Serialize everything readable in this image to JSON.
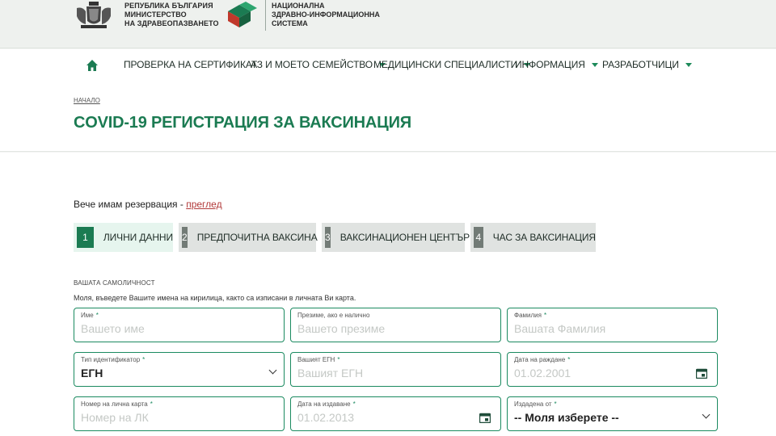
{
  "header": {
    "gov_lines": [
      "РЕПУБЛИКА БЪЛГАРИЯ",
      "МИНИСТЕРСТВО",
      "НА ЗДРАВЕОПАЗВАНЕТО"
    ],
    "nhis_lines": [
      "НАЦИОНАЛНА",
      "ЗДРАВНО-ИНФОРМАЦИОННА",
      "СИСТЕМА"
    ]
  },
  "nav": {
    "home_icon": "home-icon",
    "items": [
      {
        "label": "ПРОВЕРКА НА СЕРТИФИКАТ",
        "dropdown": false
      },
      {
        "label": "АЗ И МОЕТО СЕМЕЙСТВО",
        "dropdown": true
      },
      {
        "label": "МЕДИЦИНСКИ СПЕЦИАЛИСТИ",
        "dropdown": true
      },
      {
        "label": "ИНФОРМАЦИЯ",
        "dropdown": true
      },
      {
        "label": "РАЗРАБОТЧИЦИ",
        "dropdown": true
      }
    ]
  },
  "breadcrumb": "НАЧАЛО",
  "page_title": "COVID-19 РЕГИСТРАЦИЯ ЗА ВАКСИНАЦИЯ",
  "booking": {
    "text": "Вече имам резервация - ",
    "link": "преглед"
  },
  "steps": [
    {
      "num": "1",
      "label": "ЛИЧНИ ДАННИ"
    },
    {
      "num": "2",
      "label": "ПРЕДПОЧИТНА ВАКСИНА"
    },
    {
      "num": "3",
      "label": "ВАКСИНАЦИОНЕН ЦЕНТЪР"
    },
    {
      "num": "4",
      "label": "ЧАС ЗА ВАКСИНАЦИЯ"
    }
  ],
  "section_label": "ВАШАТА САМОЛИЧНОСТ",
  "hint": "Моля, въведете Вашите имена на кирилица, както са изписани в личната Ви карта.",
  "fields": {
    "first_name": {
      "label": "Име",
      "placeholder": "Вашето име"
    },
    "middle_name": {
      "label": "Презиме, ако е налично",
      "placeholder": "Вашето презиме"
    },
    "last_name": {
      "label": "Фамилия",
      "placeholder": "Вашата Фамилия"
    },
    "id_type": {
      "label": "Тип идентификатор",
      "value": "ЕГН"
    },
    "egn": {
      "label": "Вашият ЕГН",
      "placeholder": "Вашият ЕГН"
    },
    "birth_date": {
      "label": "Дата на раждане",
      "placeholder": "01.02.2001"
    },
    "id_card": {
      "label": "Номер на лична карта",
      "placeholder": "Номер на ЛК"
    },
    "issue_date": {
      "label": "Дата на издаване",
      "placeholder": "01.02.2013"
    },
    "issued_by": {
      "label": "Издадена от",
      "value": "-- Моля изберете --"
    }
  },
  "colors": {
    "brand_green": "#1b7b52",
    "link_red": "#b23a3a"
  }
}
